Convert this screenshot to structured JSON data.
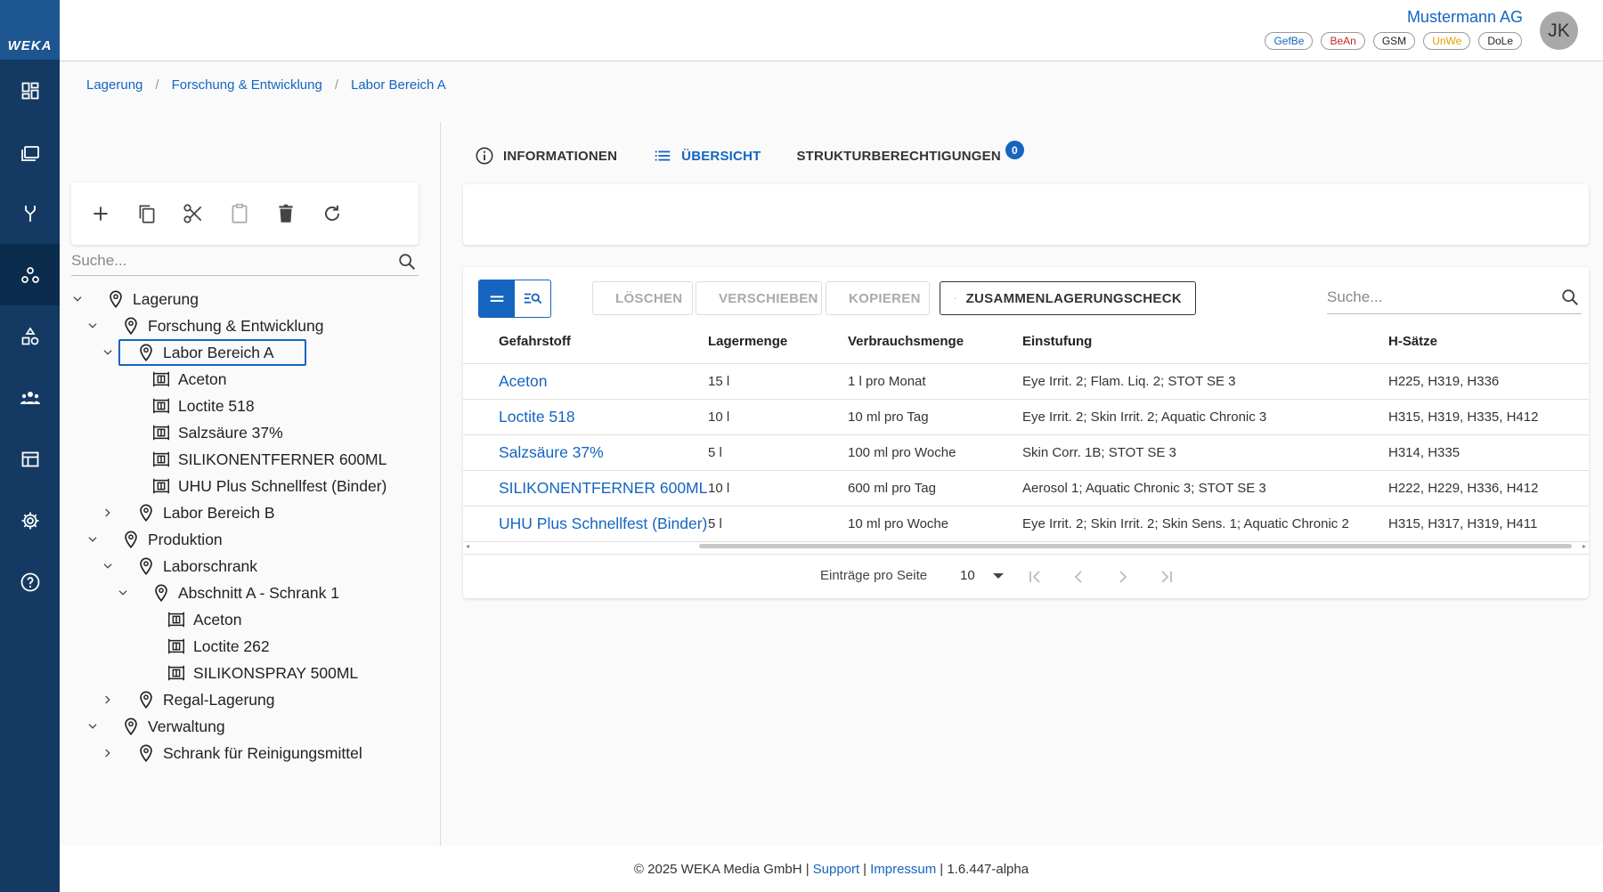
{
  "brand": {
    "logo_text": "WEKA",
    "color": "#1c5590"
  },
  "rail": {
    "items": [
      {
        "icon": "dashboard-icon"
      },
      {
        "icon": "folders-icon"
      },
      {
        "icon": "fork-icon"
      },
      {
        "icon": "hazmat-storage-icon",
        "active": true
      },
      {
        "icon": "shapes-icon"
      },
      {
        "icon": "group-icon"
      },
      {
        "icon": "table-layout-icon"
      },
      {
        "icon": "settings-icon"
      },
      {
        "icon": "help-icon"
      }
    ]
  },
  "header": {
    "company": "Mustermann AG",
    "avatar_initials": "JK",
    "tags": [
      {
        "label": "GefBe",
        "color": "#1565c0"
      },
      {
        "label": "BeAn",
        "color": "#c62828"
      },
      {
        "label": "GSM",
        "color": "#222222"
      },
      {
        "label": "UnWe",
        "color": "#e0a000"
      },
      {
        "label": "DoLe",
        "color": "#222222"
      }
    ]
  },
  "breadcrumb": [
    "Lagerung",
    "Forschung & Entwicklung",
    "Labor Bereich A"
  ],
  "tree": {
    "search_placeholder": "Suche...",
    "nodes": [
      {
        "label": "Lagerung",
        "level": 0,
        "type": "location",
        "expander": "expanded"
      },
      {
        "label": "Forschung & Entwicklung",
        "level": 1,
        "type": "location",
        "expander": "expanded"
      },
      {
        "label": "Labor Bereich A",
        "level": 2,
        "type": "location",
        "expander": "expanded",
        "selected": true
      },
      {
        "label": "Aceton",
        "level": 3,
        "type": "substance",
        "expander": "none"
      },
      {
        "label": "Loctite 518",
        "level": 3,
        "type": "substance",
        "expander": "none"
      },
      {
        "label": "Salzsäure 37%",
        "level": 3,
        "type": "substance",
        "expander": "none"
      },
      {
        "label": "SILIKONENTFERNER 600ML",
        "level": 3,
        "type": "substance",
        "expander": "none"
      },
      {
        "label": "UHU Plus Schnellfest (Binder)",
        "level": 3,
        "type": "substance",
        "expander": "none"
      },
      {
        "label": "Labor Bereich B",
        "level": 2,
        "type": "location",
        "expander": "collapsed"
      },
      {
        "label": "Produktion",
        "level": 1,
        "type": "location",
        "expander": "expanded"
      },
      {
        "label": "Laborschrank",
        "level": 2,
        "type": "location",
        "expander": "expanded"
      },
      {
        "label": "Abschnitt A - Schrank 1",
        "level": 3,
        "type": "location",
        "expander": "expanded"
      },
      {
        "label": "Aceton",
        "level": 4,
        "type": "substance",
        "expander": "none"
      },
      {
        "label": "Loctite 262",
        "level": 4,
        "type": "substance",
        "expander": "none"
      },
      {
        "label": "SILIKONSPRAY 500ML",
        "level": 4,
        "type": "substance",
        "expander": "none"
      },
      {
        "label": "Regal-Lagerung",
        "level": 2,
        "type": "location",
        "expander": "collapsed"
      },
      {
        "label": "Verwaltung",
        "level": 1,
        "type": "location",
        "expander": "expanded"
      },
      {
        "label": "Schrank für Reinigungsmittel",
        "level": 2,
        "type": "location",
        "expander": "collapsed"
      }
    ]
  },
  "tabs": {
    "info": "INFORMATIONEN",
    "overview": "ÜBERSICHT",
    "permissions": "STRUKTURBERECHTIGUNGEN",
    "permissions_badge": "0"
  },
  "actions": {
    "delete": "LÖSCHEN",
    "move": "VERSCHIEBEN",
    "copy": "KOPIEREN",
    "check": "ZUSAMMENLAGERUNGSCHECK",
    "search_placeholder": "Suche..."
  },
  "table": {
    "headers": [
      "Gefahrstoff",
      "Lagermenge",
      "Verbrauchsmenge",
      "Einstufung",
      "H-Sätze"
    ],
    "rows": [
      [
        "Aceton",
        "15 l",
        "1 l pro Monat",
        "Eye Irrit. 2; Flam. Liq. 2; STOT SE 3",
        "H225, H319, H336"
      ],
      [
        "Loctite 518",
        "10 l",
        "10 ml pro Tag",
        "Eye Irrit. 2; Skin Irrit. 2; Aquatic Chronic 3",
        "H315, H319, H335, H412"
      ],
      [
        "Salzsäure 37%",
        "5 l",
        "100 ml pro Woche",
        "Skin Corr. 1B; STOT SE 3",
        "H314, H335"
      ],
      [
        "SILIKONENTFERNER 600ML",
        "10 l",
        "600 ml pro Tag",
        "Aerosol 1; Aquatic Chronic 3; STOT SE 3",
        "H222, H229, H336, H412"
      ],
      [
        "UHU Plus Schnellfest (Binder)",
        "5 l",
        "10 ml pro Woche",
        "Eye Irrit. 2; Skin Irrit. 2; Skin Sens. 1; Aquatic Chronic 2",
        "H315, H317, H319, H411"
      ]
    ]
  },
  "pager": {
    "label": "Einträge pro Seite",
    "page_size": "10"
  },
  "footer": {
    "copyright": "© 2025 WEKA Media GmbH |",
    "support": "Support",
    "sep": "|",
    "impressum": "Impressum",
    "version": "| 1.6.447-alpha"
  }
}
